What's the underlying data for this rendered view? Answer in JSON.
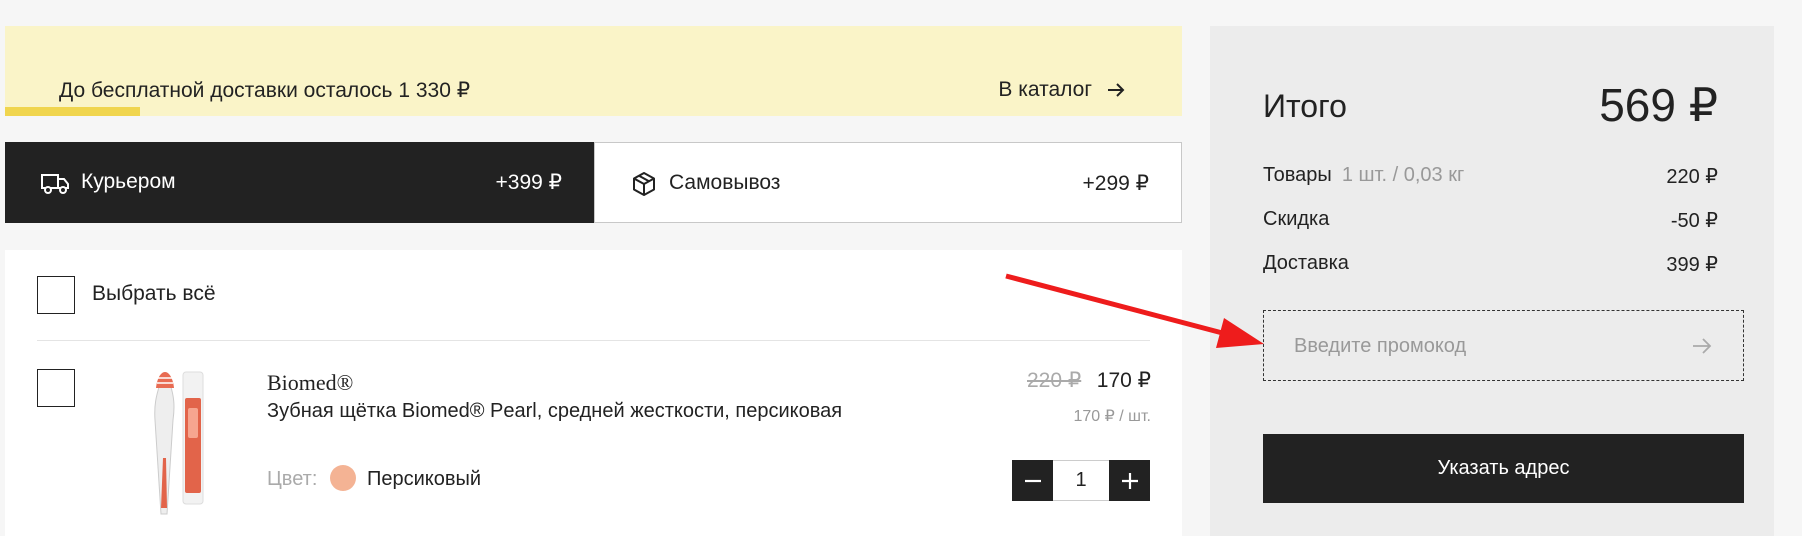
{
  "banner": {
    "free_shipping_text": "До бесплатной доставки осталось 1 330 ₽",
    "catalog_link": "В каталог",
    "progress_fraction": 0.115,
    "accent_color": "#f0d54e"
  },
  "delivery": {
    "options": [
      {
        "label": "Курьером",
        "price": "+399 ₽",
        "icon": "truck-icon",
        "selected": true
      },
      {
        "label": "Самовывоз",
        "price": "+299 ₽",
        "icon": "box-icon",
        "selected": false
      }
    ]
  },
  "cart": {
    "select_all_label": "Выбрать всё",
    "items": [
      {
        "brand": "Biomed®",
        "name": "Зубная щётка Biomed® Pearl, средней жесткости, персиковая",
        "color_label": "Цвет:",
        "color_value": "Персиковый",
        "color_swatch": "#f4b394",
        "old_price": "220 ₽",
        "price": "170 ₽",
        "unit_price": "170 ₽ / шт.",
        "quantity": "1"
      }
    ]
  },
  "summary": {
    "total_label": "Итого",
    "total_value": "569 ₽",
    "goods_label": "Товары",
    "goods_detail": "1 шт. / 0,03 кг",
    "goods_value": "220 ₽",
    "discount_label": "Скидка",
    "discount_value": "-50 ₽",
    "delivery_label": "Доставка",
    "delivery_value": "399 ₽",
    "promo_placeholder": "Введите промокод",
    "promo_value": "",
    "address_button": "Указать адрес"
  },
  "annotation": {
    "arrow_color": "#ee1c1c",
    "target": "promo-input"
  }
}
